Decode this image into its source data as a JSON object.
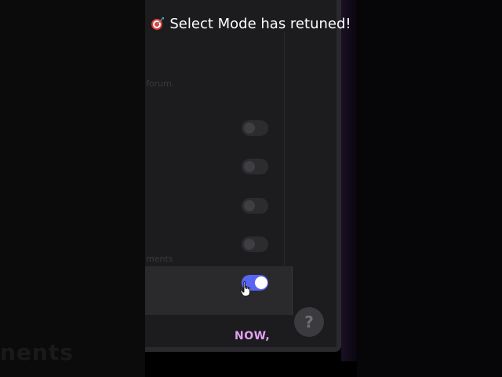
{
  "banner": {
    "icon": "target-icon",
    "text": "Select Mode has retuned!"
  },
  "panel": {
    "faint_line_1": "forum.",
    "faint_line_2": "ments",
    "toggles": [
      {
        "state": "off"
      },
      {
        "state": "off"
      },
      {
        "state": "off"
      },
      {
        "state": "off"
      },
      {
        "state": "on"
      }
    ]
  },
  "background": {
    "left_faint_text": "nents"
  },
  "help_button": {
    "label": "?"
  },
  "caption": {
    "text": "NOW,"
  },
  "colors": {
    "accent": "#5865f2",
    "caption": "#e29ef0",
    "panel": "#1c1c1e"
  }
}
